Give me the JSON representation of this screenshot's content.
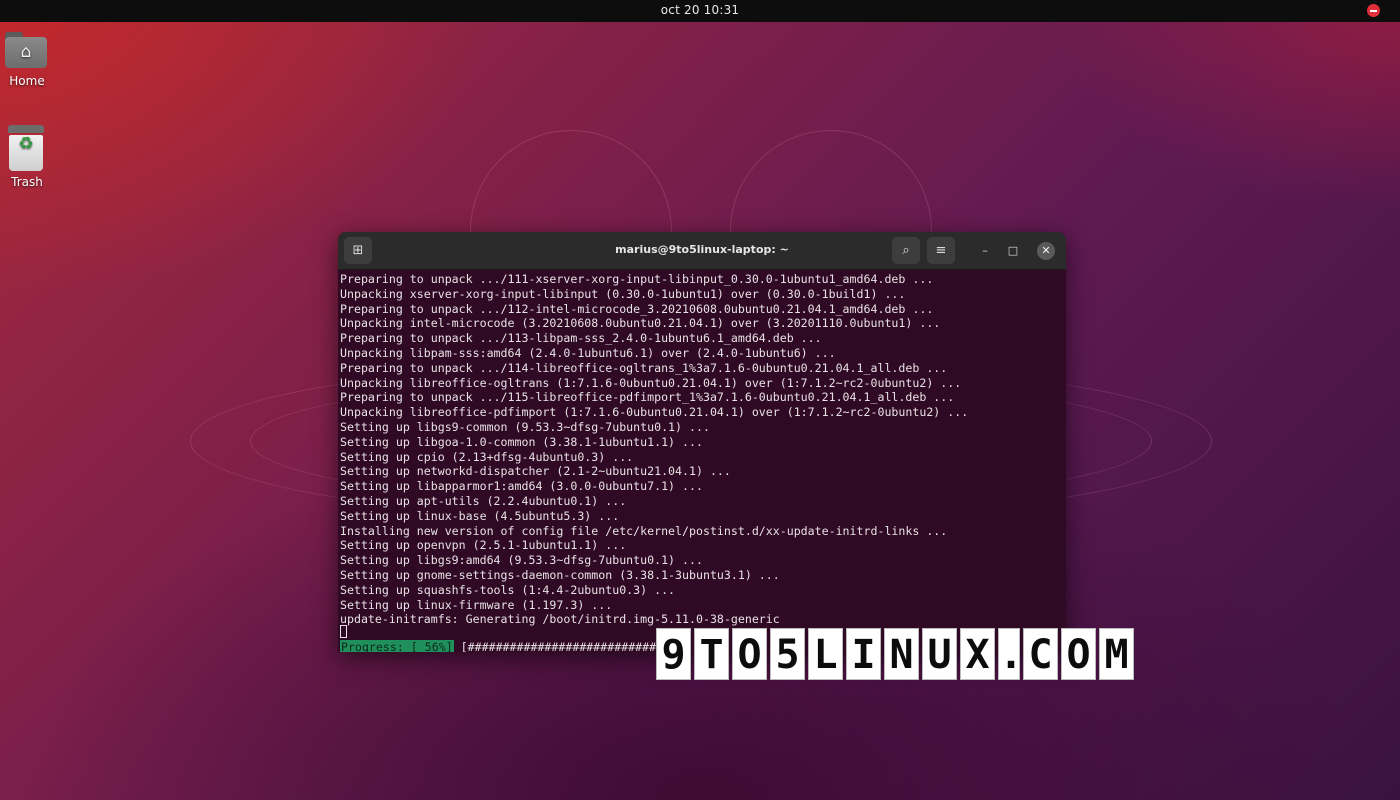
{
  "top_bar": {
    "clock": "oct 20  10:31",
    "do_not_disturb_icon": "do-not-disturb-icon",
    "do_not_disturb_color": "#e02f3a"
  },
  "desktop": {
    "icons": [
      {
        "label": "Home",
        "icon": "home-folder-icon"
      },
      {
        "label": "Trash",
        "icon": "trash-icon"
      }
    ]
  },
  "terminal": {
    "title": "marius@9to5linux-laptop: ~",
    "new_tab_glyph": "⊞",
    "search_glyph": "⌕",
    "menu_glyph": "≡",
    "minimize_glyph": "–",
    "maximize_glyph": "□",
    "close_glyph": "✕",
    "background_color": "#300a24",
    "lines": [
      "Preparing to unpack .../111-xserver-xorg-input-libinput_0.30.0-1ubuntu1_amd64.deb ...",
      "Unpacking xserver-xorg-input-libinput (0.30.0-1ubuntu1) over (0.30.0-1build1) ...",
      "Preparing to unpack .../112-intel-microcode_3.20210608.0ubuntu0.21.04.1_amd64.deb ...",
      "Unpacking intel-microcode (3.20210608.0ubuntu0.21.04.1) over (3.20201110.0ubuntu1) ...",
      "Preparing to unpack .../113-libpam-sss_2.4.0-1ubuntu6.1_amd64.deb ...",
      "Unpacking libpam-sss:amd64 (2.4.0-1ubuntu6.1) over (2.4.0-1ubuntu6) ...",
      "Preparing to unpack .../114-libreoffice-ogltrans_1%3a7.1.6-0ubuntu0.21.04.1_all.deb ...",
      "Unpacking libreoffice-ogltrans (1:7.1.6-0ubuntu0.21.04.1) over (1:7.1.2~rc2-0ubuntu2) ...",
      "Preparing to unpack .../115-libreoffice-pdfimport_1%3a7.1.6-0ubuntu0.21.04.1_all.deb ...",
      "Unpacking libreoffice-pdfimport (1:7.1.6-0ubuntu0.21.04.1) over (1:7.1.2~rc2-0ubuntu2) ...",
      "Setting up libgs9-common (9.53.3~dfsg-7ubuntu0.1) ...",
      "Setting up libgoa-1.0-common (3.38.1-1ubuntu1.1) ...",
      "Setting up cpio (2.13+dfsg-4ubuntu0.3) ...",
      "Setting up networkd-dispatcher (2.1-2~ubuntu21.04.1) ...",
      "Setting up libapparmor1:amd64 (3.0.0-0ubuntu7.1) ...",
      "Setting up apt-utils (2.2.4ubuntu0.1) ...",
      "Setting up linux-base (4.5ubuntu5.3) ...",
      "Installing new version of config file /etc/kernel/postinst.d/xx-update-initrd-links ...",
      "Setting up openvpn (2.5.1-1ubuntu1.1) ...",
      "Setting up libgs9:amd64 (9.53.3~dfsg-7ubuntu0.1) ...",
      "Setting up gnome-settings-daemon-common (3.38.1-3ubuntu3.1) ...",
      "Setting up squashfs-tools (1:4.4-2ubuntu0.3) ...",
      "Setting up linux-firmware (1.197.3) ...",
      "update-initramfs: Generating /boot/initrd.img-5.11.0-38-generic"
    ],
    "progress": {
      "label": "Progress: [ 56%]",
      "bar": "[############################",
      "percent": 56,
      "label_color": "#1f8f5c"
    }
  },
  "watermark": {
    "characters": [
      "9",
      "T",
      "O",
      "5",
      "L",
      "I",
      "N",
      "U",
      "X",
      ".",
      "C",
      "O",
      "M"
    ]
  }
}
